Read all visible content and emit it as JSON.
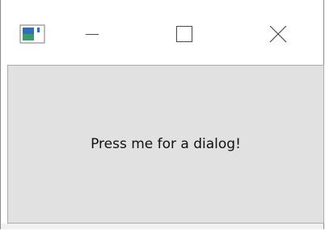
{
  "window": {
    "icon": "app-window-icon",
    "controls": {
      "minimize_icon": "minimize-icon",
      "maximize_icon": "maximize-icon",
      "close_icon": "close-icon"
    }
  },
  "main": {
    "button_label": "Press me for a dialog!"
  },
  "colors": {
    "content_bg": "#e1e1e1",
    "border": "#adadad",
    "text": "#111111"
  }
}
